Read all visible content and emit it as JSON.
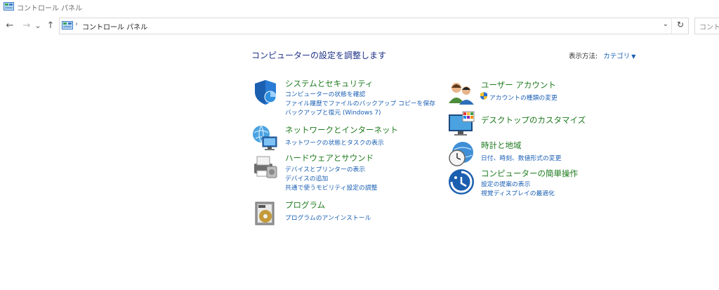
{
  "window": {
    "title": "コントロール パネル"
  },
  "address": {
    "separator": "›",
    "crumb": "コントロール パネル",
    "search_placeholder": "コントロール"
  },
  "nav": {
    "back": "←",
    "forward": "→",
    "recent": "⌄",
    "up": "↑",
    "dropdown": "⌄",
    "refresh": "↻"
  },
  "heading": "コンピューターの設定を調整します",
  "view_by": {
    "label": "表示方法:",
    "value": "カテゴリ",
    "caret": "▼"
  },
  "categories_left": [
    {
      "title": "システムとセキュリティ",
      "icon": "shield-icon",
      "links": [
        "コンピューターの状態を確認",
        "ファイル履歴でファイルのバックアップ コピーを保存",
        "バックアップと復元 (Windows 7)"
      ]
    },
    {
      "title": "ネットワークとインターネット",
      "icon": "network-icon",
      "links": [
        "ネットワークの状態とタスクの表示"
      ]
    },
    {
      "title": "ハードウェアとサウンド",
      "icon": "printer-icon",
      "links": [
        "デバイスとプリンターの表示",
        "デバイスの追加",
        "共通で使うモビリティ設定の調整"
      ]
    },
    {
      "title": "プログラム",
      "icon": "programs-icon",
      "links": [
        "プログラムのアンインストール"
      ]
    }
  ],
  "categories_right": [
    {
      "title": "ユーザー アカウント",
      "icon": "users-icon",
      "links": [
        "アカウントの種類の変更"
      ]
    },
    {
      "title": "デスクトップのカスタマイズ",
      "icon": "monitor-icon",
      "links": []
    },
    {
      "title": "時計と地域",
      "icon": "clock-globe-icon",
      "links": [
        "日付、時刻、数値形式の変更"
      ]
    },
    {
      "title": "コンピューターの簡単操作",
      "icon": "ease-of-access-icon",
      "links": [
        "設定の提案の表示",
        "視覚ディスプレイの最適化"
      ]
    }
  ],
  "colors": {
    "title_green": "#1e7a1e",
    "link_blue": "#1a5fb4",
    "heading_blue": "#1e3287"
  }
}
